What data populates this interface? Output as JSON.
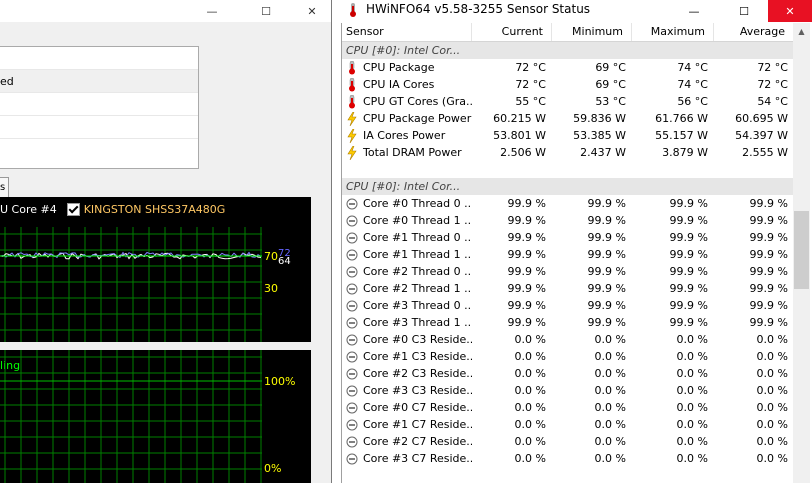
{
  "left_window": {
    "minimize_glyph": "—",
    "maximize_glyph": "☐",
    "close_glyph": "✕",
    "list_items": [
      "ed",
      "",
      "",
      "",
      ""
    ],
    "tab_label": "s",
    "graph_header": {
      "core_label": "U Core #4",
      "drive_label": "KINGSTON SHSS37A480G"
    },
    "graph1_labels": {
      "v70": "70",
      "v72": "72",
      "v64": "64",
      "v30": "30"
    },
    "graph2_labels": {
      "status": "ling",
      "top": "100%",
      "bottom": "0%"
    }
  },
  "right_window": {
    "title": "HWiNFO64 v5.58-3255 Sensor Status",
    "minimize_glyph": "—",
    "maximize_glyph": "☐",
    "close_glyph": "✕",
    "columns": [
      "Sensor",
      "Current",
      "Minimum",
      "Maximum",
      "Average"
    ],
    "rows": [
      {
        "type": "group",
        "name": "CPU [#0]: Intel Cor...",
        "current": "",
        "min": "",
        "max": "",
        "avg": ""
      },
      {
        "type": "temp",
        "name": "CPU Package",
        "current": "72 °C",
        "min": "69 °C",
        "max": "74 °C",
        "avg": "72 °C"
      },
      {
        "type": "temp",
        "name": "CPU IA Cores",
        "current": "72 °C",
        "min": "69 °C",
        "max": "74 °C",
        "avg": "72 °C"
      },
      {
        "type": "temp",
        "name": "CPU GT Cores (Gra...",
        "current": "55 °C",
        "min": "53 °C",
        "max": "56 °C",
        "avg": "54 °C"
      },
      {
        "type": "power",
        "name": "CPU Package Power",
        "current": "60.215 W",
        "min": "59.836 W",
        "max": "61.766 W",
        "avg": "60.695 W"
      },
      {
        "type": "power",
        "name": "IA Cores Power",
        "current": "53.801 W",
        "min": "53.385 W",
        "max": "55.157 W",
        "avg": "54.397 W"
      },
      {
        "type": "power",
        "name": "Total DRAM Power",
        "current": "2.506 W",
        "min": "2.437 W",
        "max": "3.879 W",
        "avg": "2.555 W"
      },
      {
        "type": "blank",
        "name": "",
        "current": "",
        "min": "",
        "max": "",
        "avg": ""
      },
      {
        "type": "group",
        "name": "CPU [#0]: Intel Cor...",
        "current": "",
        "min": "",
        "max": "",
        "avg": ""
      },
      {
        "type": "usage",
        "name": "Core #0 Thread 0 ...",
        "current": "99.9 %",
        "min": "99.9 %",
        "max": "99.9 %",
        "avg": "99.9 %"
      },
      {
        "type": "usage",
        "name": "Core #0 Thread 1 ...",
        "current": "99.9 %",
        "min": "99.9 %",
        "max": "99.9 %",
        "avg": "99.9 %"
      },
      {
        "type": "usage",
        "name": "Core #1 Thread 0 ...",
        "current": "99.9 %",
        "min": "99.9 %",
        "max": "99.9 %",
        "avg": "99.9 %"
      },
      {
        "type": "usage",
        "name": "Core #1 Thread 1 ...",
        "current": "99.9 %",
        "min": "99.9 %",
        "max": "99.9 %",
        "avg": "99.9 %"
      },
      {
        "type": "usage",
        "name": "Core #2 Thread 0 ...",
        "current": "99.9 %",
        "min": "99.9 %",
        "max": "99.9 %",
        "avg": "99.9 %"
      },
      {
        "type": "usage",
        "name": "Core #2 Thread 1 ...",
        "current": "99.9 %",
        "min": "99.9 %",
        "max": "99.9 %",
        "avg": "99.9 %"
      },
      {
        "type": "usage",
        "name": "Core #3 Thread 0 ...",
        "current": "99.9 %",
        "min": "99.9 %",
        "max": "99.9 %",
        "avg": "99.9 %"
      },
      {
        "type": "usage",
        "name": "Core #3 Thread 1 ...",
        "current": "99.9 %",
        "min": "99.9 %",
        "max": "99.9 %",
        "avg": "99.9 %"
      },
      {
        "type": "usage",
        "name": "Core #0 C3 Reside...",
        "current": "0.0 %",
        "min": "0.0 %",
        "max": "0.0 %",
        "avg": "0.0 %"
      },
      {
        "type": "usage",
        "name": "Core #1 C3 Reside...",
        "current": "0.0 %",
        "min": "0.0 %",
        "max": "0.0 %",
        "avg": "0.0 %"
      },
      {
        "type": "usage",
        "name": "Core #2 C3 Reside...",
        "current": "0.0 %",
        "min": "0.0 %",
        "max": "0.0 %",
        "avg": "0.0 %"
      },
      {
        "type": "usage",
        "name": "Core #3 C3 Reside...",
        "current": "0.0 %",
        "min": "0.0 %",
        "max": "0.0 %",
        "avg": "0.0 %"
      },
      {
        "type": "usage",
        "name": "Core #0 C7 Reside...",
        "current": "0.0 %",
        "min": "0.0 %",
        "max": "0.0 %",
        "avg": "0.0 %"
      },
      {
        "type": "usage",
        "name": "Core #1 C7 Reside...",
        "current": "0.0 %",
        "min": "0.0 %",
        "max": "0.0 %",
        "avg": "0.0 %"
      },
      {
        "type": "usage",
        "name": "Core #2 C7 Reside...",
        "current": "0.0 %",
        "min": "0.0 %",
        "max": "0.0 %",
        "avg": "0.0 %"
      },
      {
        "type": "usage",
        "name": "Core #3 C7 Reside...",
        "current": "0.0 %",
        "min": "0.0 %",
        "max": "0.0 %",
        "avg": "0.0 %"
      }
    ]
  },
  "colors": {
    "close_red": "#e81123",
    "group_bg": "#e6e6e6",
    "graph_grid": "#008000",
    "graph_bg": "#000000",
    "label_yellow": "#ffff00",
    "label_green": "#00ff00",
    "label_blue": "#6464ff"
  }
}
